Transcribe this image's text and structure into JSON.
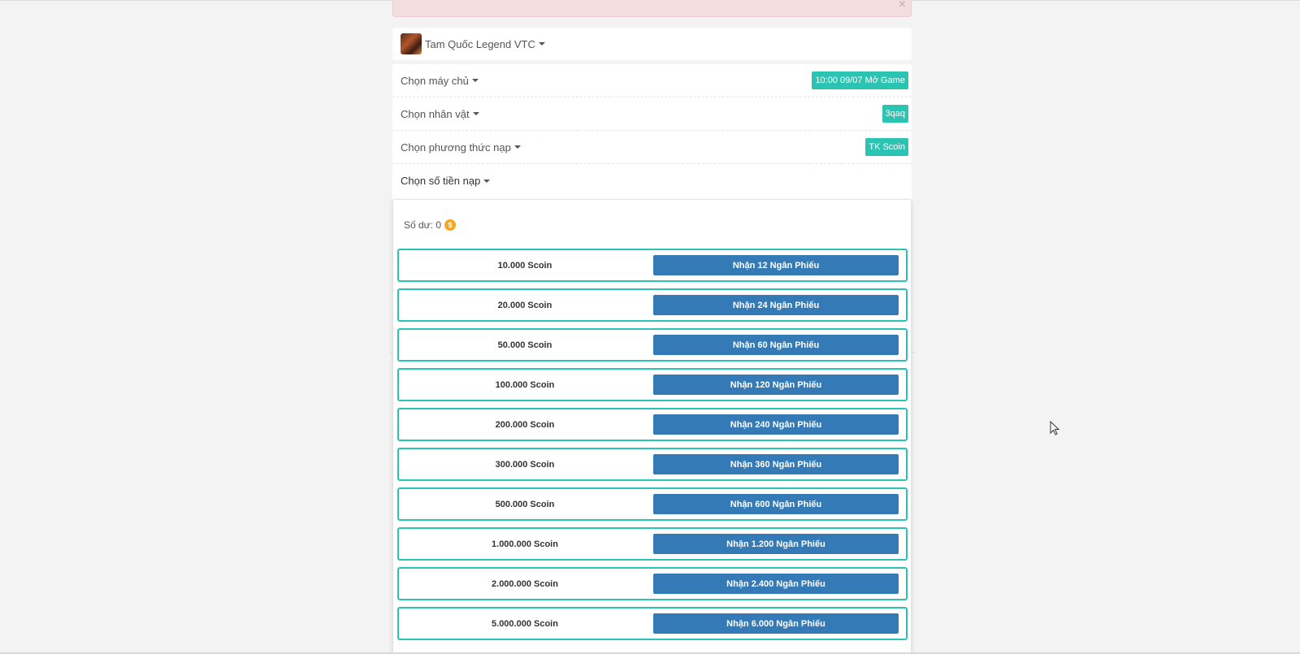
{
  "alert": {
    "close_glyph": "×"
  },
  "game": {
    "name": "Tam Quốc Legend VTC",
    "thumb_icon": "game-thumbnail"
  },
  "options": [
    {
      "label": "Chọn máy chủ",
      "tag": "10:00 09/07 Mở Game"
    },
    {
      "label": "Chọn nhân vật",
      "tag": "3qaq"
    },
    {
      "label": "Chọn phương thức nạp",
      "tag": "TK Scoin"
    },
    {
      "label": "Chọn số tiền nạp",
      "tag": ""
    }
  ],
  "balance": {
    "label": "Số dư: 0",
    "coin_icon": "coin-icon"
  },
  "packages": [
    {
      "amount": "10.000 Scoin",
      "button": "Nhận 12 Ngân Phiếu"
    },
    {
      "amount": "20.000 Scoin",
      "button": "Nhận 24 Ngân Phiếu"
    },
    {
      "amount": "50.000 Scoin",
      "button": "Nhận 60 Ngân Phiếu"
    },
    {
      "amount": "100.000 Scoin",
      "button": "Nhận 120 Ngân Phiếu"
    },
    {
      "amount": "200.000 Scoin",
      "button": "Nhận 240 Ngân Phiếu"
    },
    {
      "amount": "300.000 Scoin",
      "button": "Nhận 360 Ngân Phiếu"
    },
    {
      "amount": "500.000 Scoin",
      "button": "Nhận 600 Ngân Phiếu"
    },
    {
      "amount": "1.000.000 Scoin",
      "button": "Nhận 1.200 Ngân Phiếu"
    },
    {
      "amount": "2.000.000 Scoin",
      "button": "Nhận 2.400 Ngân Phiếu"
    },
    {
      "amount": "5.000.000 Scoin",
      "button": "Nhận 6.000 Ngân Phiếu"
    }
  ],
  "colors": {
    "accent": "#2bc4b3",
    "button": "#337ab7",
    "alert_bg": "#f2dede",
    "coin": "#f5a623"
  }
}
